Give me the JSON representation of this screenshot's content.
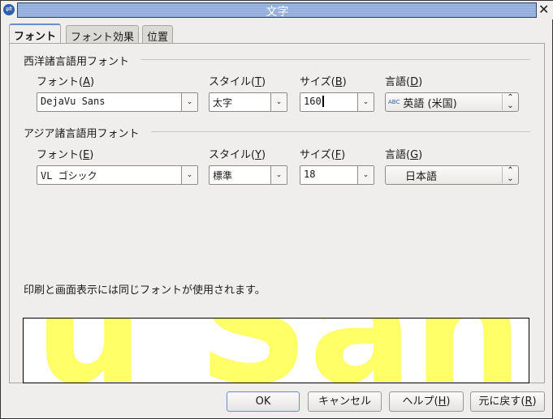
{
  "window": {
    "title": "文字",
    "app_icon": "openoffice-icon",
    "close": "✕"
  },
  "tabs": [
    {
      "label": "フォント",
      "active": true
    },
    {
      "label": "フォント効果"
    },
    {
      "label": "位置"
    }
  ],
  "western": {
    "heading": "西洋諸言語用フォント",
    "font_label": "フォント(",
    "font_key": "A",
    "style_label": "スタイル(",
    "style_key": "T",
    "size_label": "サイズ(",
    "size_key": "B",
    "lang_label": "言語(",
    "lang_key": "D",
    "close_paren": ")",
    "font": "DejaVu Sans",
    "style": "太字",
    "size": "160",
    "language": "英語 (米国)",
    "lang_icon": "ABC"
  },
  "asian": {
    "heading": "アジア諸言語用フォント",
    "font_label": "フォント(",
    "font_key": "E",
    "style_label": "スタイル(",
    "style_key": "Y",
    "size_label": "サイズ(",
    "size_key": "F",
    "lang_label": "言語(",
    "lang_key": "G",
    "close_paren": ")",
    "font": "VL ゴシック",
    "style": "標準",
    "size": "18",
    "language": "日本語"
  },
  "note": "印刷と画面表示には同じフォントが使用されます。",
  "preview": {
    "text": "DejaVu Sans",
    "color": "#ffff66"
  },
  "buttons": {
    "ok": "OK",
    "cancel": "キャンセル",
    "help": "ヘルプ(",
    "help_key": "H",
    "reset": "元に戻す(",
    "reset_key": "R",
    "close_paren": ")"
  }
}
